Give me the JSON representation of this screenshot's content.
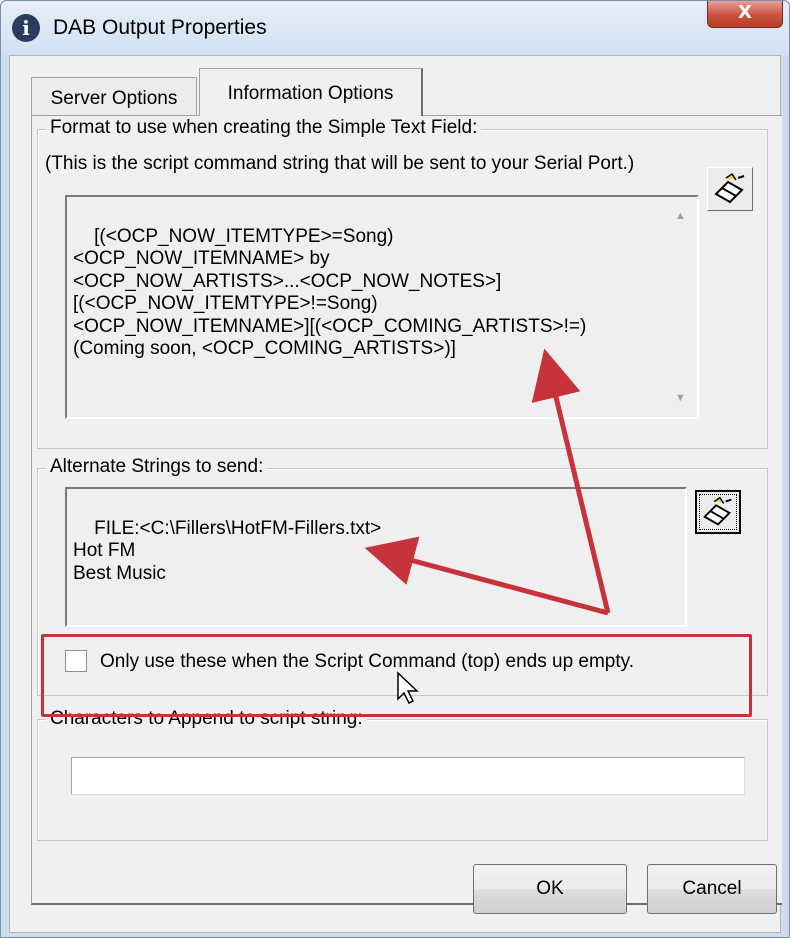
{
  "window": {
    "title": "DAB Output Properties",
    "close_label": "X"
  },
  "tabs": [
    {
      "label": "Server Options",
      "active": false
    },
    {
      "label": "Information Options",
      "active": true
    }
  ],
  "simple_text_field": {
    "group_label": "Format to use when creating the Simple Text Field:",
    "note": "(This is the script command string that will be sent to your Serial Port.)",
    "value": "[(<OCP_NOW_ITEMTYPE>=Song)\n<OCP_NOW_ITEMNAME> by\n<OCP_NOW_ARTISTS>...<OCP_NOW_NOTES>]\n[(<OCP_NOW_ITEMTYPE>!=Song)\n<OCP_NOW_ITEMNAME>][(<OCP_COMING_ARTISTS>!=)\n(Coming soon, <OCP_COMING_ARTISTS>)]"
  },
  "alternate_strings": {
    "group_label": "Alternate Strings to send:",
    "value": "FILE:<C:\\Fillers\\HotFM-Fillers.txt>\nHot FM\nBest Music",
    "checkbox_label": "Only use these when the Script Command (top) ends up empty.",
    "checkbox_checked": false
  },
  "append_characters": {
    "group_label": "Characters to Append to script string:",
    "value": ""
  },
  "buttons": {
    "ok": "OK",
    "cancel": "Cancel"
  },
  "colors": {
    "annotation": "#c8323a"
  }
}
